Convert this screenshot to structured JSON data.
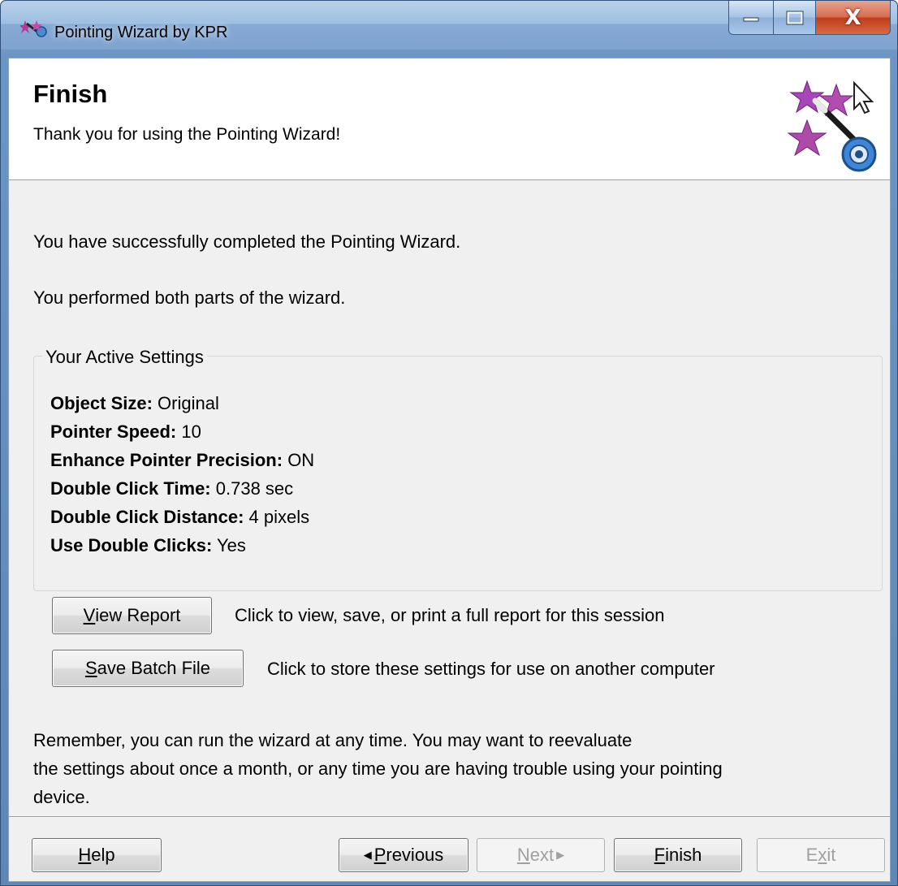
{
  "window": {
    "title": "Pointing Wizard by KPR",
    "close_glyph": "X"
  },
  "header": {
    "title": "Finish",
    "subtitle": "Thank you for using the Pointing Wizard!",
    "logo_icon": "magic-wand-stars-icon"
  },
  "messages": {
    "completed": "You have successfully completed the Pointing Wizard.",
    "parts": "You performed both parts of the wizard."
  },
  "settings": {
    "legend": "Your Active Settings",
    "items": [
      {
        "label": "Object Size:",
        "value": " Original"
      },
      {
        "label": "Pointer Speed:",
        "value": " 10"
      },
      {
        "label": "Enhance Pointer Precision:",
        "value": " ON"
      },
      {
        "label": "Double Click Time:",
        "value": " 0.738 sec"
      },
      {
        "label": "Double Click Distance:",
        "value": " 4 pixels"
      },
      {
        "label": "Use Double Clicks:",
        "value": " Yes"
      }
    ]
  },
  "actions": {
    "view_report": {
      "mnemonic": "V",
      "rest": "iew Report",
      "desc": "Click to view, save, or print a full report for this session"
    },
    "save_batch": {
      "mnemonic": "S",
      "rest": "ave Batch File",
      "desc": "Click to store these settings for use on another computer"
    }
  },
  "footer": {
    "line1": "Remember, you can run the wizard at any time. You may want to reevaluate",
    "line2": "the settings about once a month, or any time you are having trouble using your pointing",
    "line3": "device."
  },
  "nav": {
    "help": {
      "mnemonic": "H",
      "rest": "elp"
    },
    "previous": {
      "arrow": "◀",
      "mnemonic": "P",
      "rest": "revious"
    },
    "next": {
      "mnemonic": "N",
      "rest": "ext",
      "arrow": "▶"
    },
    "finish": {
      "mnemonic": "F",
      "rest": "inish"
    },
    "exit": {
      "pre": "E",
      "mnemonic": "x",
      "rest": "it"
    }
  },
  "colors": {
    "accent_title": "#9ebfe2",
    "close_red": "#c13d1b",
    "dialog_bg": "#f0f0f0"
  }
}
